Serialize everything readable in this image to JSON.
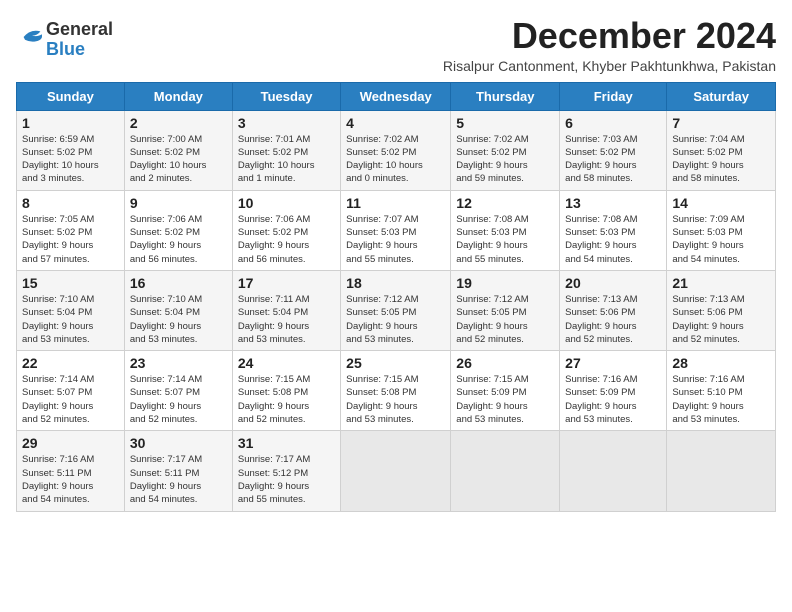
{
  "header": {
    "logo": {
      "line1": "General",
      "line2": "Blue"
    },
    "title": "December 2024",
    "subtitle": "Risalpur Cantonment, Khyber Pakhtunkhwa, Pakistan"
  },
  "weekdays": [
    "Sunday",
    "Monday",
    "Tuesday",
    "Wednesday",
    "Thursday",
    "Friday",
    "Saturday"
  ],
  "weeks": [
    [
      {
        "day": "1",
        "info": "Sunrise: 6:59 AM\nSunset: 5:02 PM\nDaylight: 10 hours\nand 3 minutes."
      },
      {
        "day": "2",
        "info": "Sunrise: 7:00 AM\nSunset: 5:02 PM\nDaylight: 10 hours\nand 2 minutes."
      },
      {
        "day": "3",
        "info": "Sunrise: 7:01 AM\nSunset: 5:02 PM\nDaylight: 10 hours\nand 1 minute."
      },
      {
        "day": "4",
        "info": "Sunrise: 7:02 AM\nSunset: 5:02 PM\nDaylight: 10 hours\nand 0 minutes."
      },
      {
        "day": "5",
        "info": "Sunrise: 7:02 AM\nSunset: 5:02 PM\nDaylight: 9 hours\nand 59 minutes."
      },
      {
        "day": "6",
        "info": "Sunrise: 7:03 AM\nSunset: 5:02 PM\nDaylight: 9 hours\nand 58 minutes."
      },
      {
        "day": "7",
        "info": "Sunrise: 7:04 AM\nSunset: 5:02 PM\nDaylight: 9 hours\nand 58 minutes."
      }
    ],
    [
      {
        "day": "8",
        "info": "Sunrise: 7:05 AM\nSunset: 5:02 PM\nDaylight: 9 hours\nand 57 minutes."
      },
      {
        "day": "9",
        "info": "Sunrise: 7:06 AM\nSunset: 5:02 PM\nDaylight: 9 hours\nand 56 minutes."
      },
      {
        "day": "10",
        "info": "Sunrise: 7:06 AM\nSunset: 5:02 PM\nDaylight: 9 hours\nand 56 minutes."
      },
      {
        "day": "11",
        "info": "Sunrise: 7:07 AM\nSunset: 5:03 PM\nDaylight: 9 hours\nand 55 minutes."
      },
      {
        "day": "12",
        "info": "Sunrise: 7:08 AM\nSunset: 5:03 PM\nDaylight: 9 hours\nand 55 minutes."
      },
      {
        "day": "13",
        "info": "Sunrise: 7:08 AM\nSunset: 5:03 PM\nDaylight: 9 hours\nand 54 minutes."
      },
      {
        "day": "14",
        "info": "Sunrise: 7:09 AM\nSunset: 5:03 PM\nDaylight: 9 hours\nand 54 minutes."
      }
    ],
    [
      {
        "day": "15",
        "info": "Sunrise: 7:10 AM\nSunset: 5:04 PM\nDaylight: 9 hours\nand 53 minutes."
      },
      {
        "day": "16",
        "info": "Sunrise: 7:10 AM\nSunset: 5:04 PM\nDaylight: 9 hours\nand 53 minutes."
      },
      {
        "day": "17",
        "info": "Sunrise: 7:11 AM\nSunset: 5:04 PM\nDaylight: 9 hours\nand 53 minutes."
      },
      {
        "day": "18",
        "info": "Sunrise: 7:12 AM\nSunset: 5:05 PM\nDaylight: 9 hours\nand 53 minutes."
      },
      {
        "day": "19",
        "info": "Sunrise: 7:12 AM\nSunset: 5:05 PM\nDaylight: 9 hours\nand 52 minutes."
      },
      {
        "day": "20",
        "info": "Sunrise: 7:13 AM\nSunset: 5:06 PM\nDaylight: 9 hours\nand 52 minutes."
      },
      {
        "day": "21",
        "info": "Sunrise: 7:13 AM\nSunset: 5:06 PM\nDaylight: 9 hours\nand 52 minutes."
      }
    ],
    [
      {
        "day": "22",
        "info": "Sunrise: 7:14 AM\nSunset: 5:07 PM\nDaylight: 9 hours\nand 52 minutes."
      },
      {
        "day": "23",
        "info": "Sunrise: 7:14 AM\nSunset: 5:07 PM\nDaylight: 9 hours\nand 52 minutes."
      },
      {
        "day": "24",
        "info": "Sunrise: 7:15 AM\nSunset: 5:08 PM\nDaylight: 9 hours\nand 52 minutes."
      },
      {
        "day": "25",
        "info": "Sunrise: 7:15 AM\nSunset: 5:08 PM\nDaylight: 9 hours\nand 53 minutes."
      },
      {
        "day": "26",
        "info": "Sunrise: 7:15 AM\nSunset: 5:09 PM\nDaylight: 9 hours\nand 53 minutes."
      },
      {
        "day": "27",
        "info": "Sunrise: 7:16 AM\nSunset: 5:09 PM\nDaylight: 9 hours\nand 53 minutes."
      },
      {
        "day": "28",
        "info": "Sunrise: 7:16 AM\nSunset: 5:10 PM\nDaylight: 9 hours\nand 53 minutes."
      }
    ],
    [
      {
        "day": "29",
        "info": "Sunrise: 7:16 AM\nSunset: 5:11 PM\nDaylight: 9 hours\nand 54 minutes."
      },
      {
        "day": "30",
        "info": "Sunrise: 7:17 AM\nSunset: 5:11 PM\nDaylight: 9 hours\nand 54 minutes."
      },
      {
        "day": "31",
        "info": "Sunrise: 7:17 AM\nSunset: 5:12 PM\nDaylight: 9 hours\nand 55 minutes."
      },
      {
        "day": "",
        "info": ""
      },
      {
        "day": "",
        "info": ""
      },
      {
        "day": "",
        "info": ""
      },
      {
        "day": "",
        "info": ""
      }
    ]
  ]
}
